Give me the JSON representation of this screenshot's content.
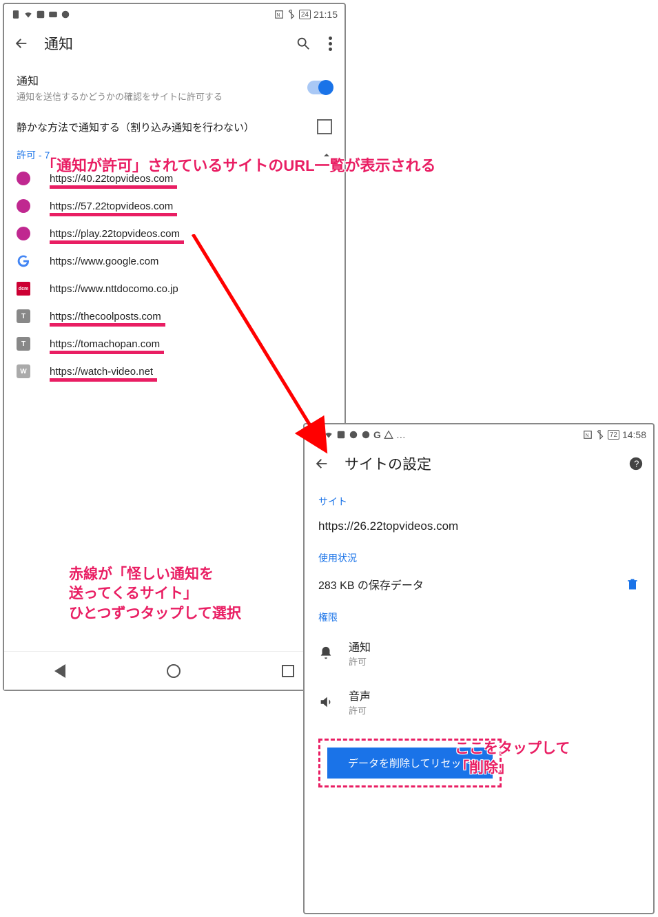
{
  "phone1": {
    "status": {
      "battery": "24",
      "time": "21:15"
    },
    "appbar": {
      "title": "通知"
    },
    "notif": {
      "label": "通知",
      "sub": "通知を送信するかどうかの確認をサイトに許可する"
    },
    "quiet": {
      "label": "静かな方法で通知する（割り込み通知を行わない）"
    },
    "allowed_header": "許可 - 7",
    "sites": [
      {
        "url": "https://40.22topvideos.com",
        "sus": true,
        "fav": "pink"
      },
      {
        "url": "https://57.22topvideos.com",
        "sus": true,
        "fav": "pink"
      },
      {
        "url": "https://play.22topvideos.com",
        "sus": true,
        "fav": "pink"
      },
      {
        "url": "https://www.google.com",
        "sus": false,
        "fav": "g"
      },
      {
        "url": "https://www.nttdocomo.co.jp",
        "sus": false,
        "fav": "dcm"
      },
      {
        "url": "https://thecoolposts.com",
        "sus": true,
        "fav": "t"
      },
      {
        "url": "https://tomachopan.com",
        "sus": true,
        "fav": "t"
      },
      {
        "url": "https://watch-video.net",
        "sus": true,
        "fav": "w"
      }
    ]
  },
  "phone2": {
    "status": {
      "battery": "72",
      "time": "14:58"
    },
    "appbar": {
      "title": "サイトの設定"
    },
    "site_hdr": "サイト",
    "site_url": "https://26.22topvideos.com",
    "usage_hdr": "使用状況",
    "usage_val": "283 KB の保存データ",
    "perm_hdr": "権限",
    "perms": {
      "notif": {
        "label": "通知",
        "state": "許可"
      },
      "sound": {
        "label": "音声",
        "state": "許可"
      }
    },
    "reset_btn": "データを削除してリセット"
  },
  "annotations": {
    "a1": "「通知が許可」されているサイトのURL一覧が表示される",
    "a2": "赤線が「怪しい通知を\n送ってくるサイト」\nひとつずつタップして選択",
    "a3": "ここをタップして\n「削除」"
  }
}
